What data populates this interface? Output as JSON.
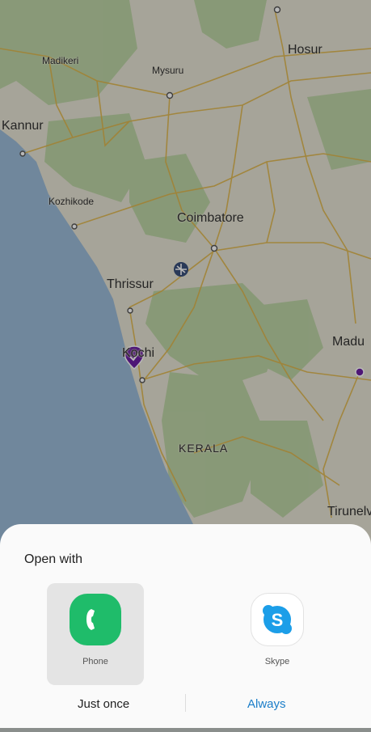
{
  "map": {
    "labels": {
      "madikeri": "Madikeri",
      "mysuru": "Mysuru",
      "hosur": "Hosur",
      "kannur": "Kannur",
      "kozhikode": "Kozhikode",
      "coimbatore": "Coimbatore",
      "thrissur": "Thrissur",
      "kochi": "Kochi",
      "madurai": "Madu",
      "kerala": "KERALA",
      "tirunelveli": "Tirunelv"
    }
  },
  "sheet": {
    "title": "Open with",
    "apps": [
      {
        "label": "Phone",
        "icon": "phone-icon",
        "color": "#1fbc6a",
        "selected": true
      },
      {
        "label": "Skype",
        "icon": "skype-icon",
        "color": "#1c9ee8",
        "selected": false
      }
    ],
    "just_once": "Just once",
    "always": "Always"
  },
  "colors": {
    "accent": "#1b7ec9",
    "pin": "#6c1fa4"
  }
}
